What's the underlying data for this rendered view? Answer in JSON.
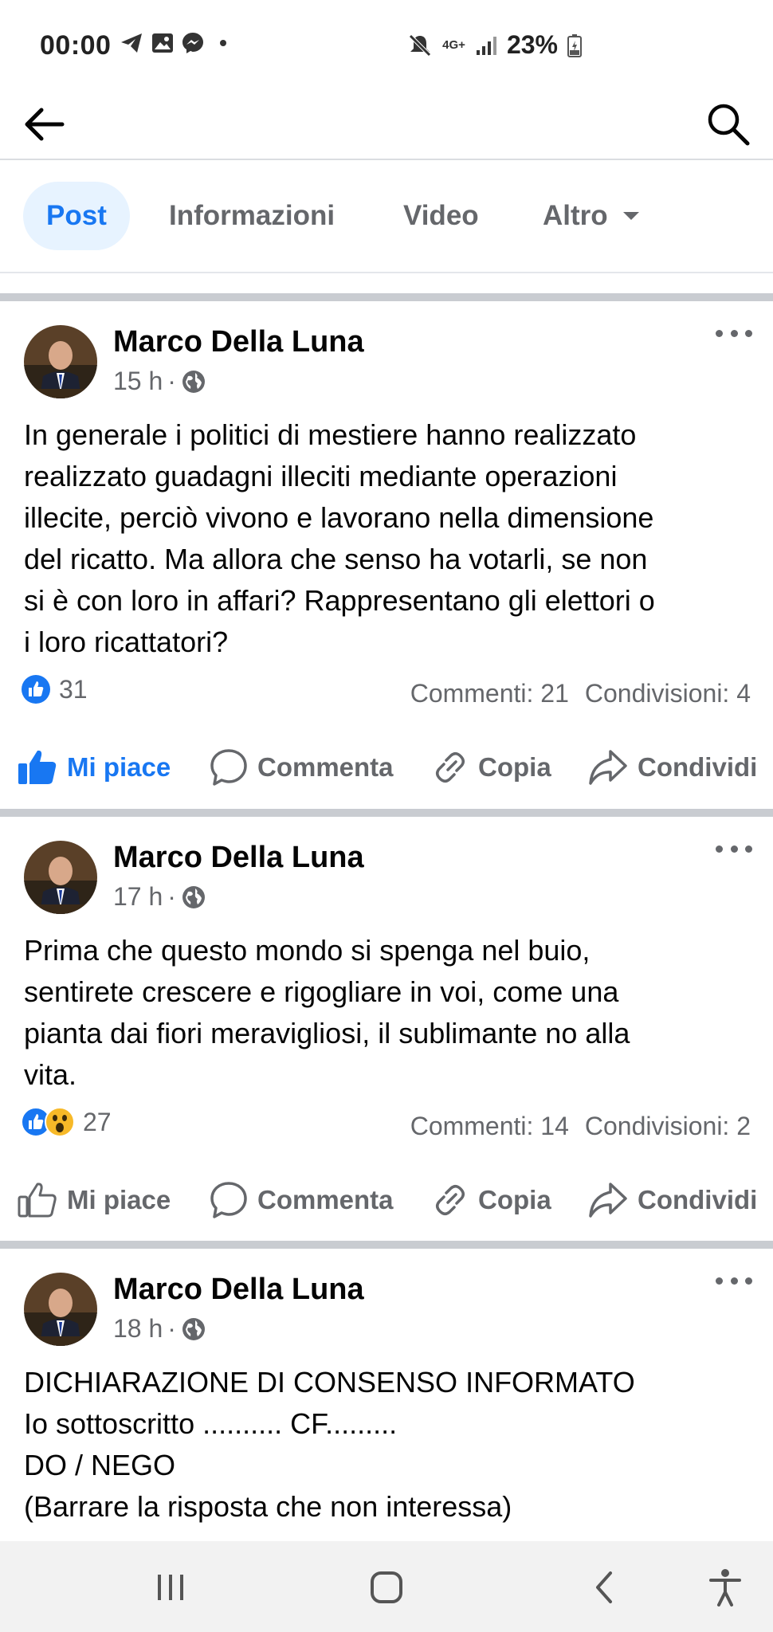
{
  "status_bar": {
    "time": "00:00",
    "battery": "23%",
    "network": "4G+",
    "icons": [
      "telegram-icon",
      "gallery-icon",
      "messenger-icon",
      "mute-icon",
      "signal-icon",
      "battery-icon"
    ]
  },
  "appbar": {
    "back_icon": "back-arrow-icon",
    "search_icon": "search-icon"
  },
  "tabs": [
    {
      "label": "Post",
      "active": true
    },
    {
      "label": "Informazioni"
    },
    {
      "label": "Video"
    },
    {
      "label": "Altro"
    }
  ],
  "posts": [
    {
      "author": "Marco Della Luna",
      "time": "15 h",
      "text": "In generale i politici di mestiere hanno realizzato\nrealizzato guadagni illeciti mediante operazioni\nillecite, perciò vivono e lavorano nella dimensione\ndel ricatto. Ma allora che senso ha votarli, se non\nsi è con loro in affari? Rappresentano gli elettori o\ni loro ricattatori?",
      "reactions_count": "31",
      "comments": "Commenti: 21",
      "shares": "Condivisioni: 4",
      "liked": true
    },
    {
      "author": "Marco Della Luna",
      "time": "17 h",
      "text": "Prima che questo mondo si spenga nel buio,\nsentirete crescere e rigogliare in voi, come una\npianta dai fiori meravigliosi, il sublimante no alla\nvita.",
      "reactions_count": "27",
      "comments": "Commenti: 14",
      "shares": "Condivisioni: 2",
      "liked": false
    },
    {
      "author": "Marco Della Luna",
      "time": "18 h",
      "text": "DICHIARAZIONE DI CONSENSO INFORMATO\nIo sottoscritto .......... CF.........\nDO / NEGO\n(Barrare la risposta che non interessa)"
    }
  ],
  "actions": {
    "like": "Mi piace",
    "comment": "Commenta",
    "copy": "Copia",
    "share": "Condividi"
  },
  "colors": {
    "accent": "#1877f2",
    "muted": "#65676b",
    "divider": "#c9ccd1"
  }
}
